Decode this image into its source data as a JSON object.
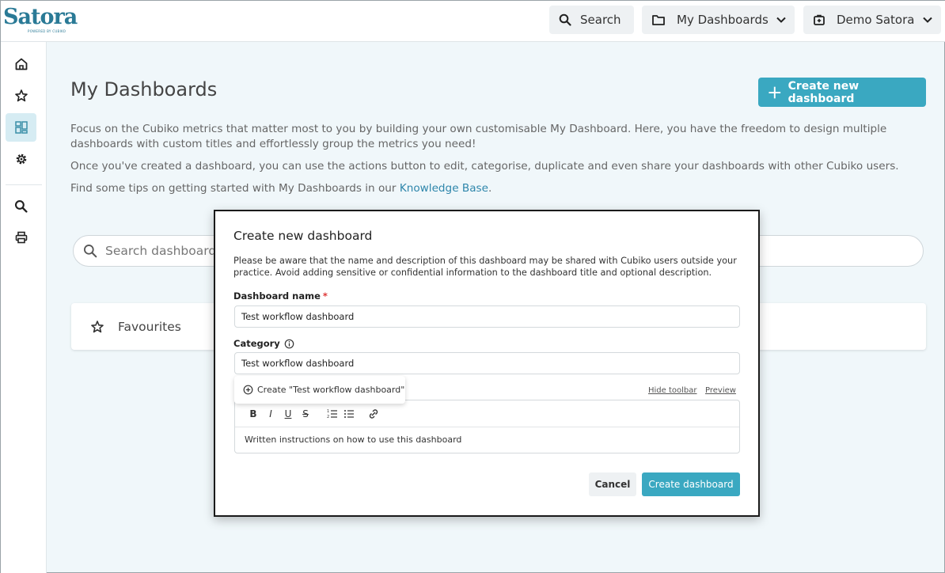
{
  "brand": {
    "logo_text": "Satora",
    "logo_sub": "POWERED BY CUBIKO",
    "accent": "#3aa8c1"
  },
  "header": {
    "search_label": "Search",
    "dashboards_label": "My Dashboards",
    "account_label": "Demo Satora"
  },
  "sidebar": {
    "items": [
      {
        "icon": "home-icon"
      },
      {
        "icon": "star-icon"
      },
      {
        "icon": "dashboard-icon",
        "active": true
      },
      {
        "icon": "gear-icon"
      },
      {
        "icon": "search-icon"
      },
      {
        "icon": "printer-icon"
      }
    ]
  },
  "main": {
    "title": "My Dashboards",
    "create_button": "Create new dashboard",
    "desc1": "Focus on the Cubiko metrics that matter most to you by building your own customisable My Dashboard. Here, you have the freedom to design multiple dashboards with custom titles and effortlessly group the metrics you need!",
    "desc2": "Once you've created a dashboard, you can use the actions button to edit, categorise, duplicate and even share your dashboards with other Cubiko users.",
    "desc3_prefix": "Find some tips on getting started with My Dashboards in our ",
    "desc3_link": "Knowledge Base",
    "desc3_suffix": ".",
    "search_placeholder": "Search dashboards",
    "favourites_label": "Favourites"
  },
  "modal": {
    "title": "Create new dashboard",
    "note": "Please be aware that the name and description of this dashboard may be shared with Cubiko users outside your practice. Avoid adding sensitive or confidential information to the dashboard title and optional description.",
    "name_label": "Dashboard name",
    "required_mark": "*",
    "name_value": "Test workflow dashboard",
    "category_label": "Category",
    "category_value": "Test workflow dashboard",
    "dropdown_option": "Create \"Test workflow dashboard\"",
    "hide_toolbar": "Hide toolbar",
    "preview": "Preview",
    "toolbar": {
      "bold": "B",
      "italic": "I",
      "underline": "U",
      "strike": "S"
    },
    "editor_text": "Written instructions on how to use this dashboard",
    "cancel": "Cancel",
    "create": "Create dashboard"
  }
}
